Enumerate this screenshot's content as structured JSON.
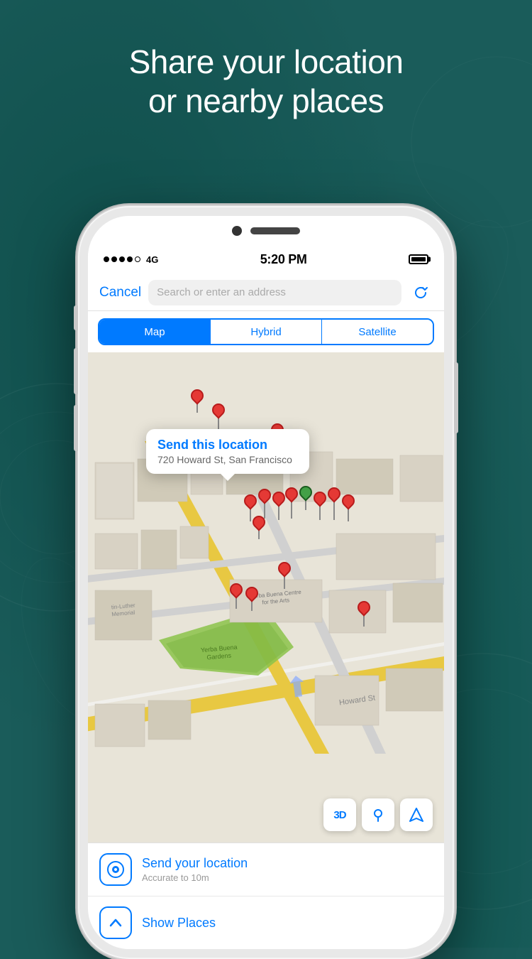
{
  "background": {
    "color": "#1a5c5a"
  },
  "header": {
    "title_line1": "Share your location",
    "title_line2": "or nearby places"
  },
  "status_bar": {
    "signal_label": "4G",
    "time": "5:20 PM",
    "battery_full": true
  },
  "nav_bar": {
    "cancel_label": "Cancel",
    "search_placeholder": "Search or enter an address",
    "refresh_icon": "↻"
  },
  "segmented_control": {
    "options": [
      {
        "label": "Map",
        "active": true
      },
      {
        "label": "Hybrid",
        "active": false
      },
      {
        "label": "Satellite",
        "active": false
      }
    ]
  },
  "map": {
    "popup": {
      "title": "Send this location",
      "address": "720 Howard St, San Francisco"
    },
    "park_label": "Yerba Buena\nGardens",
    "landmark_label": "Yerba Buena Centre\nfor the Arts",
    "controls": [
      {
        "label": "3D",
        "icon": "3D"
      },
      {
        "label": "location-pin-icon",
        "icon": "📍"
      },
      {
        "label": "navigation-icon",
        "icon": "➤"
      }
    ]
  },
  "bottom_list": {
    "items": [
      {
        "id": "send-location",
        "icon_label": "current-location-icon",
        "title": "Send your location",
        "subtitle": "Accurate to 10m"
      },
      {
        "id": "show-places",
        "icon_label": "chevron-up-icon",
        "title": "Show Places",
        "subtitle": ""
      }
    ]
  }
}
